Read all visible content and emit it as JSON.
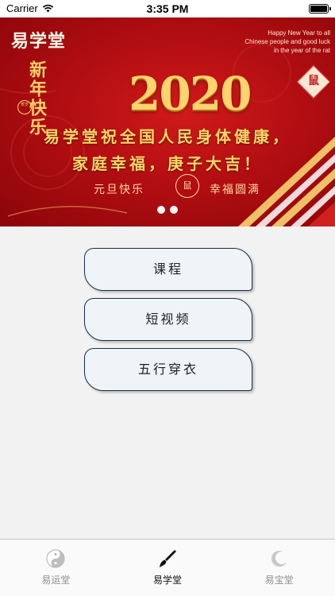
{
  "status_bar": {
    "carrier": "Carrier",
    "time": "3:35 PM",
    "wifi_icon": "wifi-icon",
    "battery_icon": "battery-icon"
  },
  "banner": {
    "brand": "易学堂",
    "english_wish": "Happy New Year to all Chinese people and good luck in the year of the rat",
    "side_greeting": "新年快乐",
    "side_seal": "贺岁",
    "year": "2020",
    "zodiac_badge": "鼠",
    "wish_line1": "易学堂祝全国人民身体健康，",
    "wish_line2": "家庭幸福，庚子大吉！",
    "sub_left": "元旦快乐",
    "sub_right": "幸福圆满",
    "sub_emblem": "鼠",
    "page_count": 2,
    "current_page": 1,
    "colors": {
      "background": "#b20e12",
      "gold": "#ffd46e"
    }
  },
  "menu": {
    "items": [
      {
        "label": "课程"
      },
      {
        "label": "短视频"
      },
      {
        "label": "五行穿衣"
      }
    ]
  },
  "tab_bar": {
    "active": "易学堂",
    "tabs": [
      {
        "label": "易运堂",
        "icon": "yin-yang-icon"
      },
      {
        "label": "易学堂",
        "icon": "brush-icon"
      },
      {
        "label": "易宝堂",
        "icon": "crescent-icon"
      }
    ]
  }
}
